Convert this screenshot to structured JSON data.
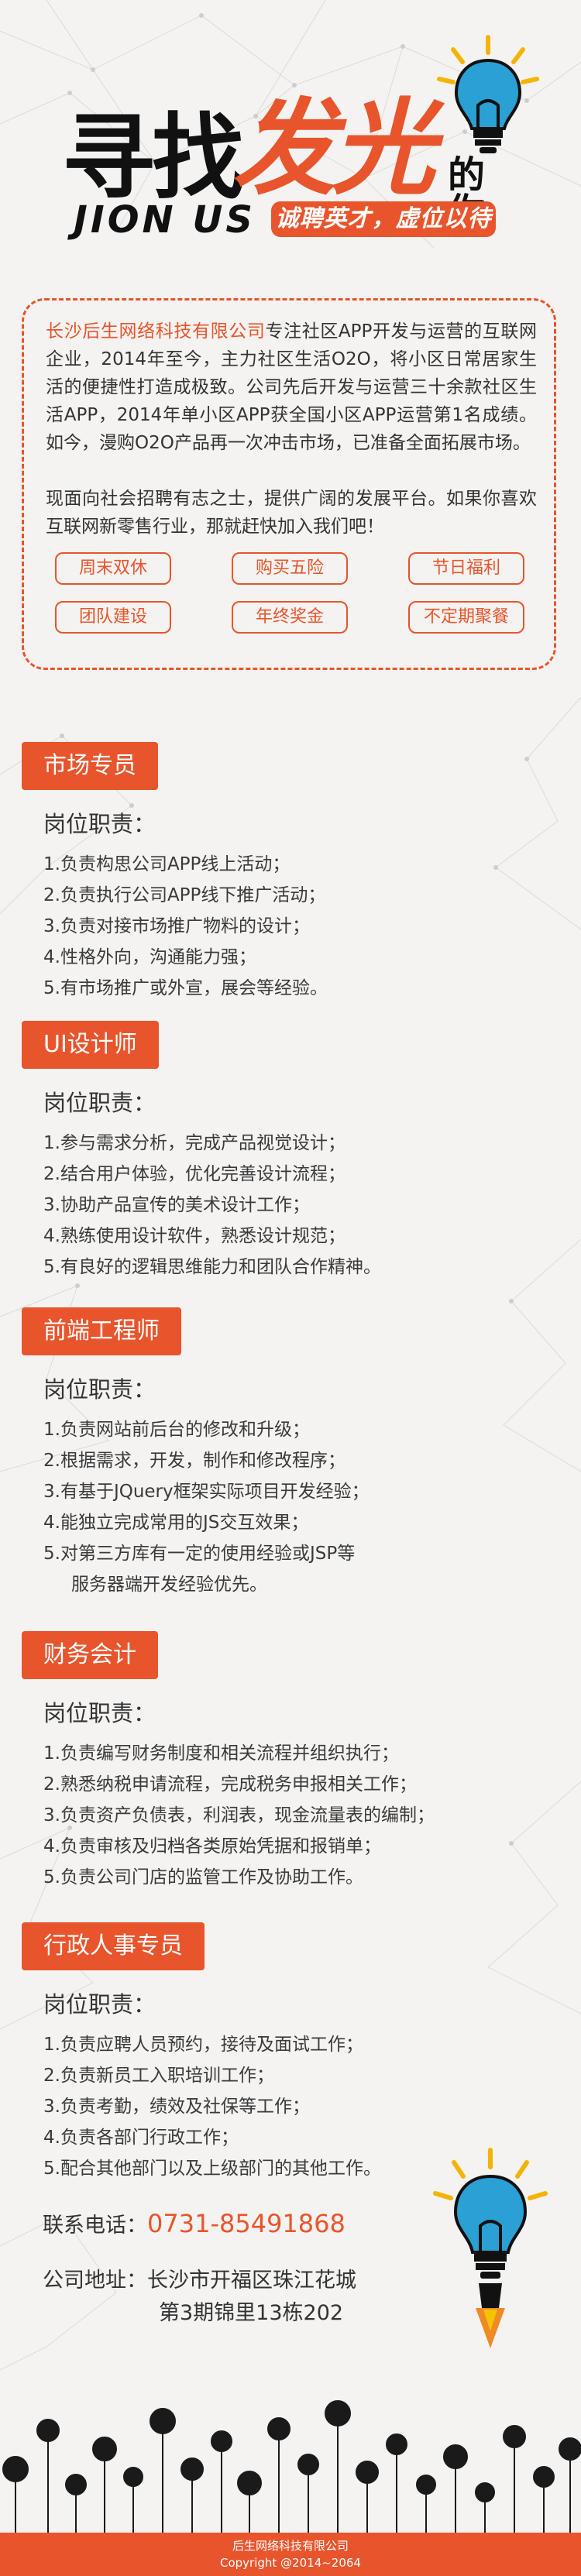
{
  "hero": {
    "title_part1": "寻找",
    "title_highlight": "发光",
    "title_suffix": "的你",
    "english": "JION US",
    "slogan": "诚聘英才，虚位以待"
  },
  "intro": {
    "company": "长沙后生网络科技有限公司",
    "paragraph1_rest": "专注社区APP开发与运营的互联网企业，2014年至今，主力社区生活O2O，将小区日常居家生活的便捷性打造成极致。公司先后开发与运营三十余款社区生活APP，2014年单小区APP获全国小区APP运营第1名成绩。如今，漫购O2O产品再一次冲击市场，已准备全面拓展市场。",
    "paragraph2": "现面向社会招聘有志之士，提供广阔的发展平台。如果你喜欢互联网新零售行业，那就赶快加入我们吧！",
    "benefits": [
      "周末双休",
      "购买五险",
      "节日福利",
      "团队建设",
      "年终奖金",
      "不定期聚餐"
    ]
  },
  "jobs": [
    {
      "title": "市场专员",
      "duty_label": "岗位职责：",
      "items": [
        "1.负责构思公司APP线上活动；",
        "2.负责执行公司APP线下推广活动；",
        "3.负责对接市场推广物料的设计；",
        "4.性格外向，沟通能力强；",
        "5.有市场推广或外宣，展会等经验。"
      ]
    },
    {
      "title": "UI设计师",
      "duty_label": "岗位职责：",
      "items": [
        "1.参与需求分析，完成产品视觉设计；",
        "2.结合用户体验，优化完善设计流程；",
        "3.协助产品宣传的美术设计工作；",
        "4.熟练使用设计软件，熟悉设计规范；",
        "5.有良好的逻辑思维能力和团队合作精神。"
      ]
    },
    {
      "title": "前端工程师",
      "duty_label": "岗位职责：",
      "items": [
        "1.负责网站前后台的修改和升级；",
        "2.根据需求，开发，制作和修改程序；",
        "3.有基于JQuery框架实际项目开发经验；",
        "4.能独立完成常用的JS交互效果；",
        "5.对第三方库有一定的使用经验或JSP等",
        "服务器端开发经验优先。"
      ]
    },
    {
      "title": "财务会计",
      "duty_label": "岗位职责：",
      "items": [
        "1.负责编写财务制度和相关流程并组织执行；",
        "2.熟悉纳税申请流程，完成税务申报相关工作；",
        "3.负责资产负债表，利润表，现金流量表的编制；",
        "4.负责审核及归档各类原始凭据和报销单；",
        "5.负责公司门店的监管工作及协助工作。"
      ]
    },
    {
      "title": "行政人事专员",
      "duty_label": "岗位职责：",
      "items": [
        "1.负责应聘人员预约，接待及面试工作；",
        "2.负责新员工入职培训工作；",
        "3.负责考勤，绩效及社保等工作；",
        "4.负责各部门行政工作；",
        "5.配合其他部门以及上级部门的其他工作。"
      ]
    }
  ],
  "contact": {
    "phone_label": "联系电话：",
    "phone": "0731-85491868",
    "address_label": "公司地址：",
    "address_line1": "长沙市开福区珠江花城",
    "address_line2": "第3期锦里13栋202"
  },
  "footer": {
    "company": "后生网络科技有限公司",
    "copyright": "Copyright @2014~2064"
  },
  "colors": {
    "accent": "#e8552c",
    "bulb_blue": "#2aa0d4",
    "bulb_rays": "#f5b400"
  }
}
